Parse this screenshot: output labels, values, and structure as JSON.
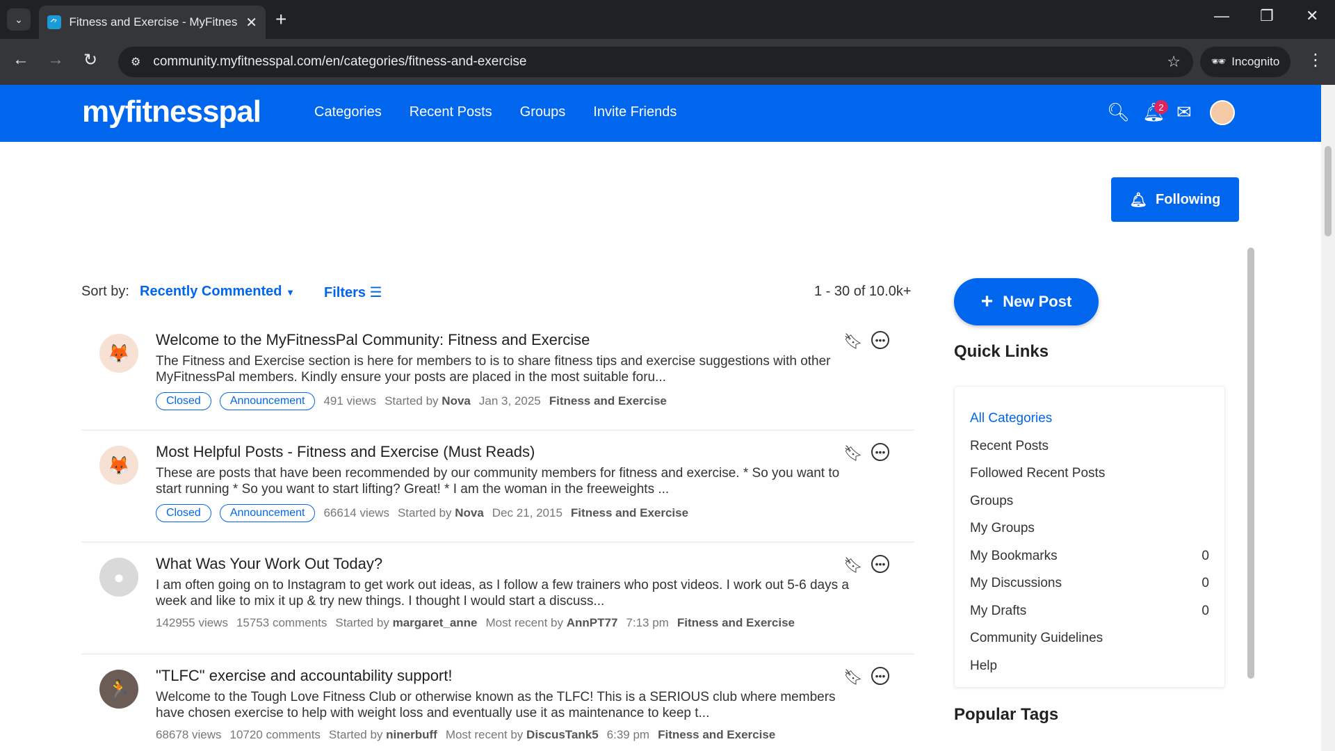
{
  "browser": {
    "tab_title": "Fitness and Exercise - MyFitnes",
    "url": "community.myfitnesspal.com/en/categories/fitness-and-exercise",
    "incognito_label": "Incognito"
  },
  "header": {
    "logo": "myfitnesspal",
    "nav": [
      "Categories",
      "Recent Posts",
      "Groups",
      "Invite Friends"
    ],
    "notification_count": "2"
  },
  "follow_button": "Following",
  "sortbar": {
    "label": "Sort by:",
    "value": "Recently Commented",
    "filters": "Filters",
    "count": "1 - 30 of 10.0k+"
  },
  "posts": [
    {
      "title": "Welcome to the MyFitnessPal Community: Fitness and Exercise",
      "excerpt": "The Fitness and Exercise section is here for members to is to share fitness tips and exercise suggestions with other MyFitnessPal members. Kindly ensure your posts are placed in the most suitable foru...",
      "tags": [
        "Closed",
        "Announcement"
      ],
      "views": "491 views",
      "started_by_label": "Started by",
      "author": "Nova",
      "date": "Jan 3, 2025",
      "category": "Fitness and Exercise"
    },
    {
      "title": "Most Helpful Posts - Fitness and Exercise (Must Reads)",
      "excerpt": "These are posts that have been recommended by our community members for fitness and exercise. * So you want to start running * So you want to start lifting? Great! * I am the woman in the freeweights ...",
      "tags": [
        "Closed",
        "Announcement"
      ],
      "views": "66614 views",
      "started_by_label": "Started by",
      "author": "Nova",
      "date": "Dec 21, 2015",
      "category": "Fitness and Exercise"
    },
    {
      "title": "What Was Your Work Out Today?",
      "excerpt": "I am often going on to Instagram to get work out ideas, as I follow a few trainers who post videos. I work out 5-6 days a week and like to mix it up & try new things. I thought I would start a discuss...",
      "views": "142955 views",
      "comments": "15753 comments",
      "started_by_label": "Started by",
      "author": "margaret_anne",
      "recent_label": "Most recent by",
      "recent_author": "AnnPT77",
      "time": "7:13 pm",
      "category": "Fitness and Exercise"
    },
    {
      "title": "\"TLFC\" exercise and accountability support!",
      "excerpt": "Welcome to the Tough Love Fitness Club or otherwise known as the TLFC! This is a SERIOUS club where members have chosen exercise to help with weight loss and eventually use it as maintenance to keep t...",
      "views": "68678 views",
      "comments": "10720 comments",
      "started_by_label": "Started by",
      "author": "ninerbuff",
      "recent_label": "Most recent by",
      "recent_author": "DiscusTank5",
      "time": "6:39 pm",
      "category": "Fitness and Exercise"
    }
  ],
  "sidebar": {
    "new_post": "New Post",
    "quick_links_title": "Quick Links",
    "quick_links": [
      {
        "label": "All Categories",
        "count": ""
      },
      {
        "label": "Recent Posts",
        "count": ""
      },
      {
        "label": "Followed Recent Posts",
        "count": ""
      },
      {
        "label": "Groups",
        "count": ""
      },
      {
        "label": "My Groups",
        "count": ""
      },
      {
        "label": "My Bookmarks",
        "count": "0"
      },
      {
        "label": "My Discussions",
        "count": "0"
      },
      {
        "label": "My Drafts",
        "count": "0"
      },
      {
        "label": "Community Guidelines",
        "count": ""
      },
      {
        "label": "Help",
        "count": ""
      }
    ],
    "popular_tags_title": "Popular Tags"
  }
}
